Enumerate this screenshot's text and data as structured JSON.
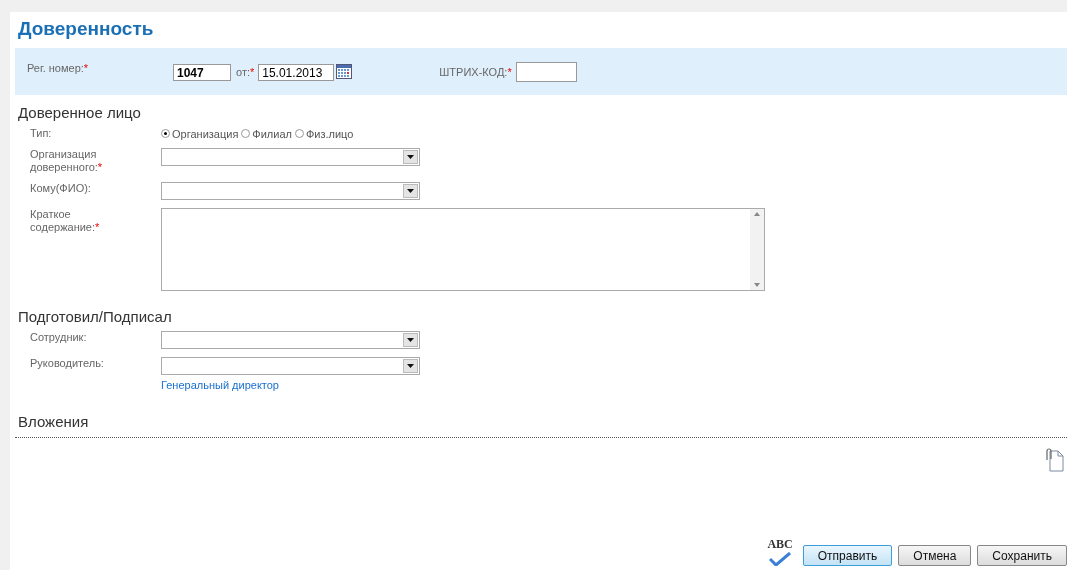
{
  "title": "Доверенность",
  "header": {
    "reg_label": "Рег. номер:",
    "reg_mark": "*",
    "reg_value": "1047",
    "date_label": "от:",
    "date_mark": "*",
    "date_value": "15.01.2013",
    "barcode_label": "ШТРИХ-КОД:",
    "barcode_mark": "*"
  },
  "sections": [
    {
      "heading": "Доверенное лицо",
      "rows": [
        {
          "kind": "radio",
          "label": "Тип:",
          "options": [
            {
              "label": "Организация",
              "selected": true
            },
            {
              "label": "Филиал",
              "selected": false
            },
            {
              "label": "Физ.лицо",
              "selected": false
            }
          ]
        },
        {
          "kind": "select",
          "label": "Организация доверенного:",
          "mark": "*"
        },
        {
          "kind": "select",
          "label": "Кому(ФИО):"
        },
        {
          "kind": "textarea",
          "label": "Краткое содержание:",
          "mark": "*"
        }
      ]
    },
    {
      "heading": "Подготовил/Подписал",
      "rows": [
        {
          "kind": "select",
          "label": "Сотрудник:"
        },
        {
          "kind": "select",
          "label": "Руководитель:",
          "link": "Генеральный директор"
        }
      ]
    }
  ],
  "attachments": {
    "heading": "Вложения"
  },
  "spellcheck": "ABC",
  "buttons": [
    {
      "label": "Отправить",
      "selected": true
    },
    {
      "label": "Отмена",
      "selected": false
    },
    {
      "label": "Сохранить",
      "selected": false
    }
  ]
}
